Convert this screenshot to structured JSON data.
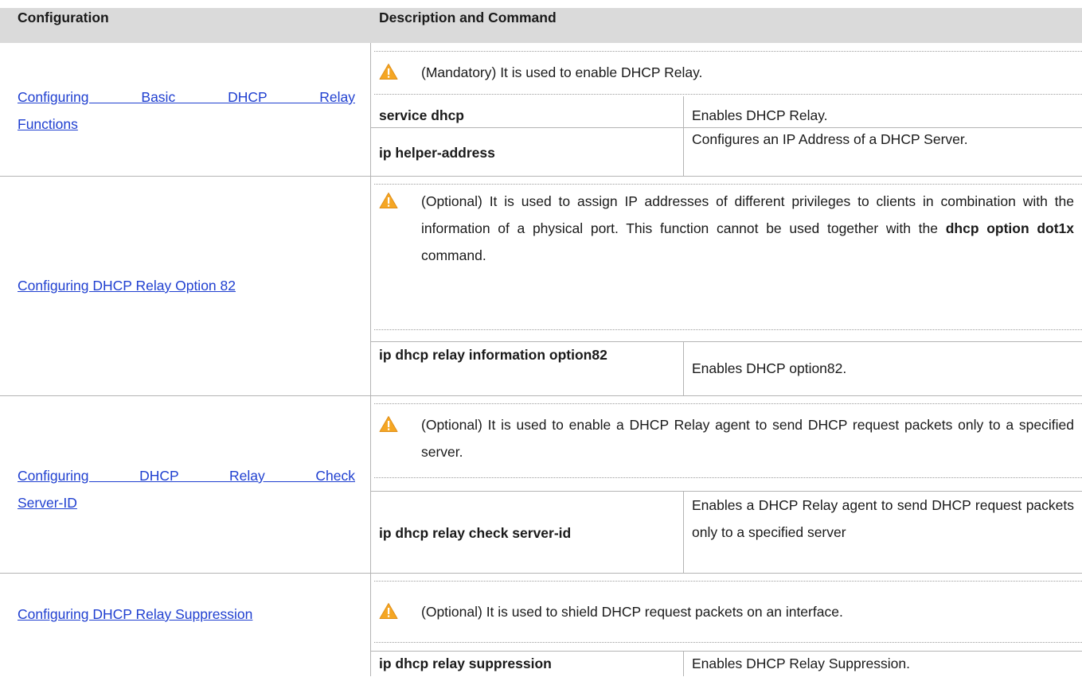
{
  "header": {
    "col1": "Configuration",
    "col2": "Description and Command"
  },
  "sections": [
    {
      "link": "Configuring Basic DHCP Relay Functions",
      "link_lines": [
        "Configuring Basic DHCP Relay",
        "Functions"
      ],
      "note": "(Mandatory) It is used to enable DHCP Relay.",
      "commands": [
        {
          "command": "service dhcp",
          "description": "Enables DHCP Relay."
        },
        {
          "command": "ip helper-address",
          "description": "Configures an IP Address of a DHCP Server."
        }
      ]
    },
    {
      "link": "Configuring DHCP Relay Option 82",
      "note_parts": [
        "(Optional) It is used to assign IP addresses of different privileges to clients in combination with the information of a physical port. This function cannot be used together with the ",
        "dhcp option dot1x",
        " command."
      ],
      "commands": [
        {
          "command": "ip dhcp relay information option82",
          "description": "Enables DHCP option82."
        }
      ]
    },
    {
      "link": "Configuring DHCP Relay Check Server-ID",
      "link_lines": [
        "Configuring DHCP Relay Check",
        "Server-ID"
      ],
      "note": "(Optional) It is used to enable a DHCP Relay agent to send DHCP request packets only to a specified server.",
      "commands": [
        {
          "command": "ip dhcp relay check server-id",
          "description": "Enables a DHCP Relay agent to send DHCP request packets only to a specified server"
        }
      ]
    },
    {
      "link": "Configuring DHCP Relay Suppression",
      "note": "(Optional) It is used to shield DHCP request packets on an interface.",
      "commands": [
        {
          "command": "ip dhcp relay suppression",
          "description": "Enables DHCP Relay Suppression."
        }
      ]
    }
  ],
  "icons": {
    "warning": "warning-triangle-icon",
    "warning_color": "#f5a623"
  }
}
